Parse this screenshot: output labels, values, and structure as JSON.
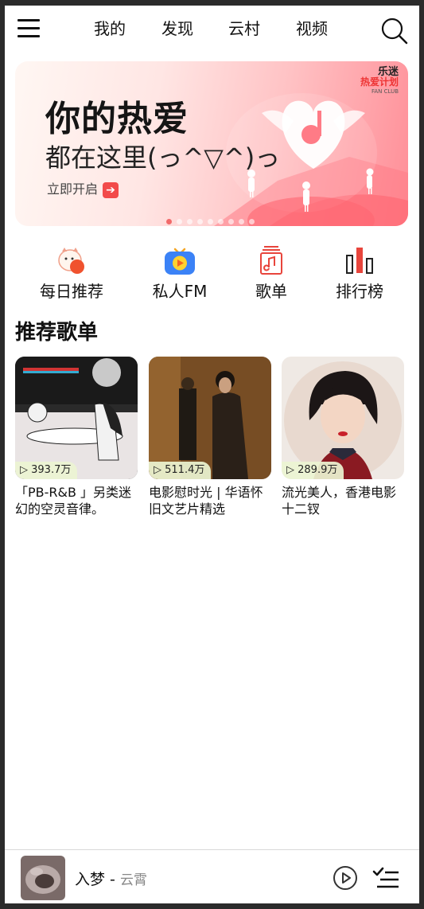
{
  "top_nav": {
    "tabs": [
      {
        "label": "我的"
      },
      {
        "label": "发现"
      },
      {
        "label": "云村"
      },
      {
        "label": "视频"
      }
    ]
  },
  "banner": {
    "title": "你的热爱",
    "subtitle": "都在这里(っ^▽^)っ",
    "cta": "立即开启",
    "brand_line1": "乐迷",
    "brand_line2": "热爱计划",
    "brand_line3": "FAN CLUB",
    "slide_count": 9,
    "active_slide": 1
  },
  "quick_entries": [
    {
      "label": "每日推荐",
      "icon": "daily-recommend-icon"
    },
    {
      "label": "私人FM",
      "icon": "personal-fm-icon"
    },
    {
      "label": "歌单",
      "icon": "playlist-icon"
    },
    {
      "label": "排行榜",
      "icon": "chart-rank-icon"
    }
  ],
  "section": {
    "title": "推荐歌单"
  },
  "playlists": [
    {
      "plays": "▷ 393.7万",
      "title": "「PB-R&B 」另类迷幻的空灵音律。"
    },
    {
      "plays": "▷ 511.4万",
      "title": "电影慰时光 | 华语怀旧文艺片精选"
    },
    {
      "plays": "▷ 289.9万",
      "title": "流光美人，香港电影十二钗"
    }
  ],
  "player": {
    "song": "入梦",
    "separator": " - ",
    "artist": "云霄"
  },
  "colors": {
    "accent": "#f24a4a",
    "text": "#111111",
    "muted": "#888888"
  }
}
